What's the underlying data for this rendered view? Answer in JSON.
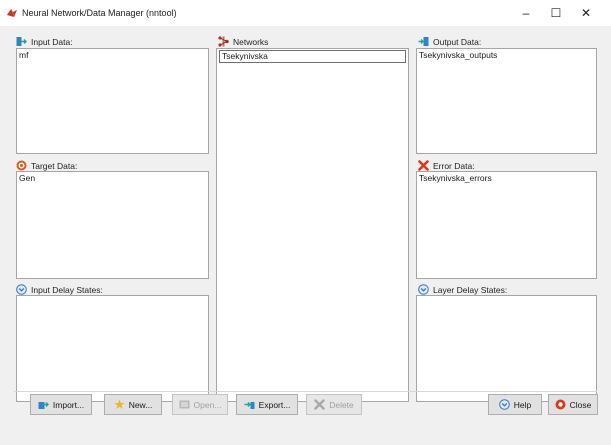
{
  "window": {
    "title": "Neural Network/Data Manager (nntool)",
    "controls": {
      "minimize": "–",
      "maximize": "☐",
      "close": "✕"
    }
  },
  "panels": {
    "input_data": {
      "label": "Input Data:",
      "icon": "input-data-icon",
      "items": [
        "mf"
      ]
    },
    "target_data": {
      "label": "Target Data:",
      "icon": "target-icon",
      "items": [
        "Gen"
      ]
    },
    "input_delay_states": {
      "label": "Input Delay States:",
      "icon": "delay-states-icon",
      "items": []
    },
    "networks": {
      "label": "Networks",
      "icon": "network-icon",
      "items": [
        "Tsekynivska"
      ]
    },
    "output_data": {
      "label": "Output Data:",
      "icon": "output-data-icon",
      "items": [
        "Tsekynivska_outputs"
      ]
    },
    "error_data": {
      "label": "Error Data:",
      "icon": "error-icon",
      "items": [
        "Tsekynivska_errors"
      ]
    },
    "layer_delay_states": {
      "label": "Layer Delay States:",
      "icon": "delay-states-icon",
      "items": []
    }
  },
  "buttons": {
    "import": {
      "label": "Import...",
      "enabled": true
    },
    "new": {
      "label": "New...",
      "enabled": true
    },
    "open": {
      "label": "Open...",
      "enabled": false
    },
    "export": {
      "label": "Export...",
      "enabled": true
    },
    "delete": {
      "label": "Delete",
      "enabled": false
    },
    "help": {
      "label": "Help",
      "enabled": true
    },
    "close": {
      "label": "Close",
      "enabled": true
    }
  },
  "colors": {
    "input_icon": "#2e86c1",
    "output_icon": "#2aa198",
    "target_icon": "#e0561b",
    "error_icon": "#d9381e",
    "network_icon": "#b03a2e",
    "delay_icon": "#3a78c9"
  }
}
